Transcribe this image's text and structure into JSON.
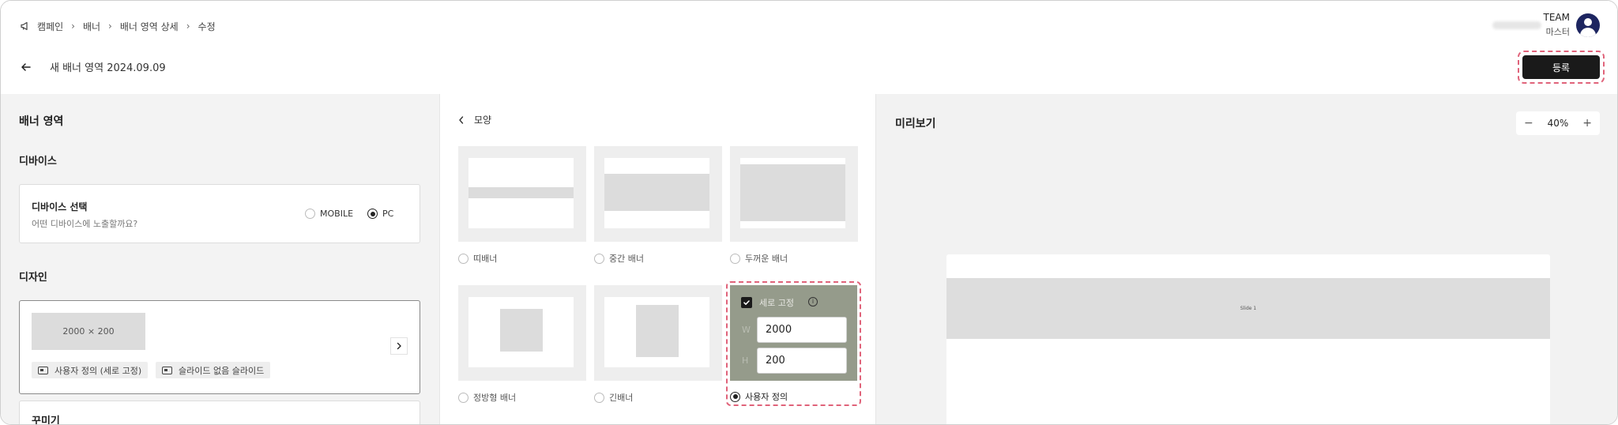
{
  "breadcrumb": [
    "캠페인",
    "배너",
    "배너 영역 상세",
    "수정"
  ],
  "page": {
    "title": "새 배너 영역 2024.09.09"
  },
  "user": {
    "team": "TEAM",
    "role": "마스터"
  },
  "actions": {
    "register_label": "등록"
  },
  "left": {
    "section_title": "배너 영역",
    "device": {
      "heading": "디바이스",
      "card_title": "디바이스 선택",
      "card_desc": "어떤 디바이스에 노출할까요?",
      "options": [
        {
          "label": "MOBILE",
          "selected": false
        },
        {
          "label": "PC",
          "selected": true
        }
      ]
    },
    "design": {
      "heading": "디자인",
      "preview_size": "2000 × 200",
      "tags": [
        "사용자 정의  (세로 고정)",
        "슬라이드 없음 슬라이드"
      ]
    },
    "decor": {
      "heading": "꾸미기"
    }
  },
  "middle": {
    "heading": "모양",
    "shapes": [
      {
        "label": "띠배너",
        "selected": false
      },
      {
        "label": "중간 배너",
        "selected": false
      },
      {
        "label": "두꺼운 배너",
        "selected": false
      },
      {
        "label": "정방형 배너",
        "selected": false
      },
      {
        "label": "긴배너",
        "selected": false
      },
      {
        "label": "사용자 정의",
        "selected": true
      }
    ],
    "custom": {
      "fixed_height_label": "세로 고정",
      "fixed_height_checked": true,
      "width_label": "W",
      "width_value": "2000",
      "height_label": "H",
      "height_value": "200"
    }
  },
  "preview": {
    "title": "미리보기",
    "zoom": "40%",
    "slide_label": "Slide 1"
  },
  "colors": {
    "accent_dashed": "#e0637a",
    "button_dark": "#1a1a1a",
    "custom_panel": "#959b8b"
  }
}
